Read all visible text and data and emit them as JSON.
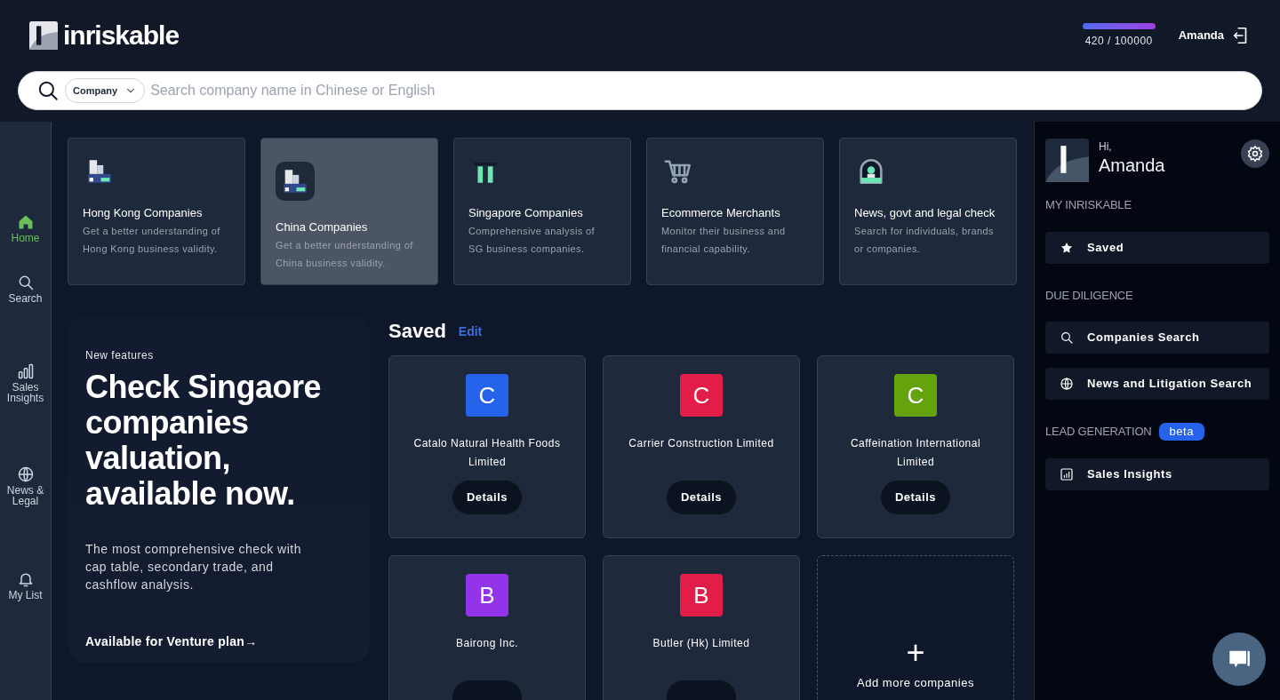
{
  "header": {
    "logo": "inriskable",
    "usage": "420 / 100000",
    "user": "Amanda"
  },
  "search": {
    "scope": "Company",
    "placeholder": "Search company name in Chinese or English"
  },
  "nav": [
    {
      "label": "Home",
      "selected": true
    },
    {
      "label": "Search",
      "selected": false
    },
    {
      "label": "Sales Insights",
      "selected": false
    },
    {
      "label": "News & Legal",
      "selected": false
    },
    {
      "label": "My List",
      "selected": false
    }
  ],
  "categories": [
    {
      "title": "Hong Kong Companies",
      "text": "Get a better understanding of Hong Kong business validity.",
      "selected": false
    },
    {
      "title": "China Companies",
      "text": "Get a better understanding of China business validity.",
      "selected": true
    },
    {
      "title": "Singapore Companies",
      "text": "Comprehensive analysis of SG business companies.",
      "selected": false
    },
    {
      "title": "Ecommerce Merchants",
      "text": "Monitor their business and financial capability.",
      "selected": false
    },
    {
      "title": "News, govt and legal check",
      "text": "Search for individuals, brands or companies.",
      "selected": false
    }
  ],
  "feature": {
    "eyebrow": "New features",
    "headline": "Check Singaore companies valuation, available now.",
    "body": "The most comprehensive check with cap table, secondary trade, and cashflow analysis.",
    "link": "Available for Venture plan→"
  },
  "saved": {
    "title": "Saved",
    "edit": "Edit",
    "companies": [
      {
        "letter": "C",
        "name": "Catalo Natural Health Foods Limited",
        "color": "#2563eb",
        "button": "Details"
      },
      {
        "letter": "C",
        "name": "Carrier Construction Limited",
        "color": "#e11d48",
        "button": "Details"
      },
      {
        "letter": "C",
        "name": "Caffeination International Limited",
        "color": "#65a30d",
        "button": "Details"
      },
      {
        "letter": "B",
        "name": "Bairong Inc.",
        "color": "#9333ea"
      },
      {
        "letter": "B",
        "name": "Butler (Hk) Limited",
        "color": "#e11d48"
      }
    ],
    "add": {
      "icon": "+",
      "label": "Add more companies"
    }
  },
  "panel": {
    "greeting": "Hi,",
    "name": "Amanda",
    "sections": [
      {
        "title": "MY INRISKABLE",
        "items": [
          {
            "label": "Saved"
          }
        ]
      },
      {
        "title": "DUE DILIGENCE",
        "items": [
          {
            "label": "Companies Search"
          },
          {
            "label": "News and Litigation Search"
          }
        ]
      },
      {
        "title": "LEAD GENERATION",
        "badge": "beta",
        "items": [
          {
            "label": "Sales Insights"
          }
        ]
      }
    ]
  }
}
